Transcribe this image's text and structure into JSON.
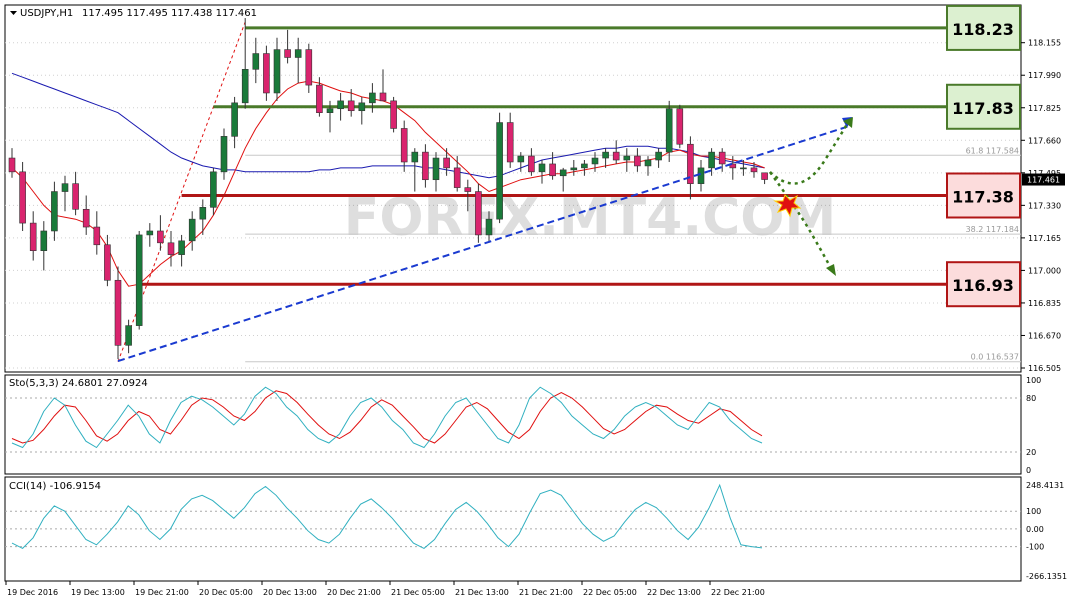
{
  "symbol": "USDJPY,H1",
  "ohlc": "117.495 117.495 117.438 117.461",
  "watermark": "FOREX.MT4.COM",
  "colors": {
    "up": "#1a7a3a",
    "down": "#d9246e",
    "ma_fast": "#e01010",
    "ma_slow": "#1a1ab0",
    "support": "#b01515",
    "resistance": "#4a7a2a",
    "trend": "#1a3ad0",
    "support_box": "#fcdcdc",
    "resistance_box": "#dcf0d0",
    "stoch_main": "#30b0c0",
    "cci": "#30b0c0"
  },
  "main_panel": {
    "price_labels": [
      "118.155",
      "117.990",
      "117.825",
      "117.660",
      "117.495",
      "117.330",
      "117.165",
      "117.000",
      "116.835",
      "116.670",
      "116.505"
    ],
    "current_price": "117.461",
    "levels": [
      {
        "label": "118.23",
        "price": 118.23,
        "kind": "resistance"
      },
      {
        "label": "117.83",
        "price": 117.83,
        "kind": "resistance"
      },
      {
        "label": "117.38",
        "price": 117.38,
        "kind": "support"
      },
      {
        "label": "116.93",
        "price": 116.93,
        "kind": "support"
      }
    ],
    "fib_labels": [
      "61.8 117.584",
      "38.2 117.184",
      "0.0 116.537"
    ]
  },
  "stochastic": {
    "title": "Sto(5,3,3) 24.6801 27.0924",
    "scale": [
      "100",
      "80",
      "20",
      "0"
    ]
  },
  "cci": {
    "title": "CCI(14) -106.9154",
    "scale": [
      "248.4131",
      "100",
      "0.00",
      "-100",
      "-266.1351"
    ]
  },
  "time_labels": [
    "19 Dec 2016",
    "19 Dec 13:00",
    "19 Dec 21:00",
    "20 Dec 05:00",
    "20 Dec 13:00",
    "20 Dec 21:00",
    "21 Dec 05:00",
    "21 Dec 13:00",
    "21 Dec 21:00",
    "22 Dec 05:00",
    "22 Dec 13:00",
    "22 Dec 21:00"
  ],
  "chart_data": {
    "type": "candlestick",
    "title": "USDJPY,H1",
    "ylim": [
      116.505,
      118.26
    ],
    "candles": [
      [
        117.57,
        117.62,
        117.47,
        117.5
      ],
      [
        117.5,
        117.55,
        117.2,
        117.24
      ],
      [
        117.24,
        117.3,
        117.05,
        117.1
      ],
      [
        117.1,
        117.25,
        117.0,
        117.2
      ],
      [
        117.2,
        117.45,
        117.15,
        117.4
      ],
      [
        117.4,
        117.48,
        117.3,
        117.44
      ],
      [
        117.44,
        117.5,
        117.28,
        117.31
      ],
      [
        117.31,
        117.38,
        117.18,
        117.22
      ],
      [
        117.22,
        117.3,
        117.08,
        117.13
      ],
      [
        117.13,
        117.18,
        116.92,
        116.95
      ],
      [
        116.95,
        117.02,
        116.55,
        116.62
      ],
      [
        116.62,
        116.75,
        116.58,
        116.72
      ],
      [
        116.72,
        117.2,
        116.7,
        117.18
      ],
      [
        117.18,
        117.24,
        117.12,
        117.2
      ],
      [
        117.2,
        117.28,
        117.1,
        117.14
      ],
      [
        117.14,
        117.2,
        117.02,
        117.08
      ],
      [
        117.08,
        117.18,
        117.02,
        117.15
      ],
      [
        117.15,
        117.3,
        117.1,
        117.26
      ],
      [
        117.26,
        117.36,
        117.18,
        117.32
      ],
      [
        117.32,
        117.52,
        117.28,
        117.5
      ],
      [
        117.5,
        117.72,
        117.46,
        117.68
      ],
      [
        117.68,
        117.88,
        117.62,
        117.85
      ],
      [
        117.85,
        118.28,
        117.82,
        118.02
      ],
      [
        118.02,
        118.18,
        117.95,
        118.1
      ],
      [
        118.1,
        118.14,
        117.86,
        117.9
      ],
      [
        117.9,
        118.18,
        117.86,
        118.12
      ],
      [
        118.12,
        118.22,
        118.05,
        118.08
      ],
      [
        118.08,
        118.18,
        117.95,
        118.12
      ],
      [
        118.12,
        118.15,
        117.9,
        117.94
      ],
      [
        117.94,
        117.98,
        117.78,
        117.8
      ],
      [
        117.8,
        117.86,
        117.7,
        117.82
      ],
      [
        117.82,
        117.9,
        117.76,
        117.86
      ],
      [
        117.86,
        117.92,
        117.78,
        117.81
      ],
      [
        117.81,
        117.88,
        117.74,
        117.85
      ],
      [
        117.85,
        117.95,
        117.8,
        117.9
      ],
      [
        117.9,
        118.02,
        117.86,
        117.86
      ],
      [
        117.86,
        117.88,
        117.7,
        117.72
      ],
      [
        117.72,
        117.76,
        117.5,
        117.55
      ],
      [
        117.55,
        117.62,
        117.4,
        117.6
      ],
      [
        117.6,
        117.64,
        117.42,
        117.46
      ],
      [
        117.46,
        117.6,
        117.4,
        117.57
      ],
      [
        117.57,
        117.62,
        117.48,
        117.52
      ],
      [
        117.52,
        117.58,
        117.4,
        117.42
      ],
      [
        117.42,
        117.46,
        117.3,
        117.4
      ],
      [
        117.4,
        117.44,
        117.14,
        117.18
      ],
      [
        117.18,
        117.3,
        117.14,
        117.26
      ],
      [
        117.26,
        117.8,
        117.24,
        117.75
      ],
      [
        117.75,
        117.8,
        117.52,
        117.55
      ],
      [
        117.55,
        117.6,
        117.5,
        117.58
      ],
      [
        117.58,
        117.62,
        117.48,
        117.5
      ],
      [
        117.5,
        117.56,
        117.44,
        117.54
      ],
      [
        117.54,
        117.6,
        117.46,
        117.48
      ],
      [
        117.48,
        117.52,
        117.4,
        117.51
      ],
      [
        117.51,
        117.56,
        117.48,
        117.52
      ],
      [
        117.52,
        117.56,
        117.48,
        117.54
      ],
      [
        117.54,
        117.6,
        117.5,
        117.57
      ],
      [
        117.57,
        117.62,
        117.52,
        117.6
      ],
      [
        117.6,
        117.66,
        117.54,
        117.56
      ],
      [
        117.56,
        117.62,
        117.5,
        117.58
      ],
      [
        117.58,
        117.62,
        117.5,
        117.53
      ],
      [
        117.53,
        117.58,
        117.48,
        117.56
      ],
      [
        117.56,
        117.62,
        117.52,
        117.6
      ],
      [
        117.6,
        117.86,
        117.55,
        117.82
      ],
      [
        117.82,
        117.84,
        117.62,
        117.64
      ],
      [
        117.64,
        117.68,
        117.36,
        117.44
      ],
      [
        117.44,
        117.56,
        117.4,
        117.52
      ],
      [
        117.52,
        117.62,
        117.48,
        117.6
      ],
      [
        117.6,
        117.62,
        117.5,
        117.54
      ],
      [
        117.54,
        117.58,
        117.46,
        117.52
      ],
      [
        117.52,
        117.56,
        117.48,
        117.52
      ],
      [
        117.52,
        117.55,
        117.47,
        117.5
      ],
      [
        117.495,
        117.495,
        117.438,
        117.461
      ]
    ],
    "ma_fast": [
      117.52,
      117.47,
      117.4,
      117.33,
      117.28,
      117.27,
      117.26,
      117.24,
      117.2,
      117.12,
      117.0,
      116.92,
      116.93,
      116.98,
      117.03,
      117.07,
      117.1,
      117.15,
      117.2,
      117.28,
      117.38,
      117.5,
      117.62,
      117.72,
      117.8,
      117.87,
      117.92,
      117.95,
      117.96,
      117.95,
      117.93,
      117.91,
      117.9,
      117.88,
      117.87,
      117.86,
      117.84,
      117.8,
      117.76,
      117.7,
      117.65,
      117.6,
      117.55,
      117.5,
      117.44,
      117.4,
      117.42,
      117.44,
      117.46,
      117.47,
      117.48,
      117.49,
      117.49,
      117.5,
      117.51,
      117.52,
      117.53,
      117.54,
      117.55,
      117.55,
      117.56,
      117.57,
      117.6,
      117.61,
      117.59,
      117.58,
      117.58,
      117.57,
      117.56,
      117.55,
      117.54,
      117.52
    ],
    "ma_slow": [
      118.0,
      117.98,
      117.96,
      117.94,
      117.92,
      117.9,
      117.88,
      117.86,
      117.84,
      117.82,
      117.8,
      117.76,
      117.72,
      117.68,
      117.64,
      117.6,
      117.57,
      117.55,
      117.53,
      117.52,
      117.51,
      117.51,
      117.5,
      117.5,
      117.5,
      117.5,
      117.5,
      117.5,
      117.5,
      117.51,
      117.51,
      117.52,
      117.52,
      117.52,
      117.53,
      117.53,
      117.53,
      117.53,
      117.53,
      117.52,
      117.52,
      117.51,
      117.5,
      117.49,
      117.48,
      117.47,
      117.48,
      117.5,
      117.52,
      117.54,
      117.56,
      117.57,
      117.58,
      117.59,
      117.6,
      117.61,
      117.62,
      117.62,
      117.63,
      117.63,
      117.63,
      117.62,
      117.62,
      117.61,
      117.6,
      117.58,
      117.57,
      117.56,
      117.55,
      117.54,
      117.53,
      117.52
    ],
    "fib_retracement": [
      {
        "level": "61.8",
        "price": 117.584
      },
      {
        "level": "38.2",
        "price": 117.184
      },
      {
        "level": "0.0",
        "price": 116.537
      }
    ],
    "stochastic": {
      "main": [
        30,
        25,
        40,
        65,
        80,
        72,
        50,
        32,
        25,
        40,
        55,
        72,
        60,
        40,
        30,
        55,
        75,
        82,
        78,
        70,
        60,
        50,
        62,
        82,
        92,
        85,
        70,
        60,
        45,
        35,
        30,
        40,
        60,
        75,
        80,
        70,
        55,
        45,
        30,
        25,
        40,
        60,
        75,
        80,
        65,
        50,
        35,
        30,
        50,
        80,
        92,
        85,
        75,
        60,
        50,
        40,
        35,
        45,
        60,
        70,
        75,
        70,
        60,
        50,
        45,
        60,
        75,
        70,
        55,
        45,
        35,
        30
      ],
      "signal": [
        35,
        30,
        33,
        45,
        60,
        72,
        70,
        55,
        38,
        32,
        40,
        55,
        65,
        60,
        45,
        40,
        55,
        72,
        80,
        78,
        70,
        60,
        55,
        65,
        80,
        88,
        85,
        75,
        62,
        50,
        40,
        35,
        42,
        55,
        70,
        78,
        72,
        60,
        48,
        35,
        30,
        40,
        55,
        70,
        75,
        68,
        55,
        42,
        35,
        45,
        65,
        80,
        86,
        80,
        70,
        58,
        46,
        40,
        45,
        55,
        65,
        72,
        70,
        62,
        55,
        52,
        60,
        68,
        65,
        55,
        45,
        38
      ]
    },
    "cci": [
      -80,
      -110,
      -50,
      60,
      130,
      100,
      20,
      -60,
      -90,
      -30,
      40,
      130,
      80,
      -10,
      -60,
      0,
      110,
      170,
      190,
      160,
      110,
      60,
      120,
      200,
      240,
      190,
      120,
      60,
      -10,
      -60,
      -80,
      -30,
      60,
      140,
      170,
      120,
      60,
      -10,
      -80,
      -110,
      -60,
      30,
      110,
      150,
      100,
      30,
      -50,
      -100,
      -30,
      90,
      200,
      220,
      190,
      110,
      30,
      -30,
      -70,
      -40,
      40,
      110,
      150,
      120,
      60,
      -10,
      -60,
      10,
      120,
      248,
      60,
      -90,
      -100,
      -107
    ]
  }
}
